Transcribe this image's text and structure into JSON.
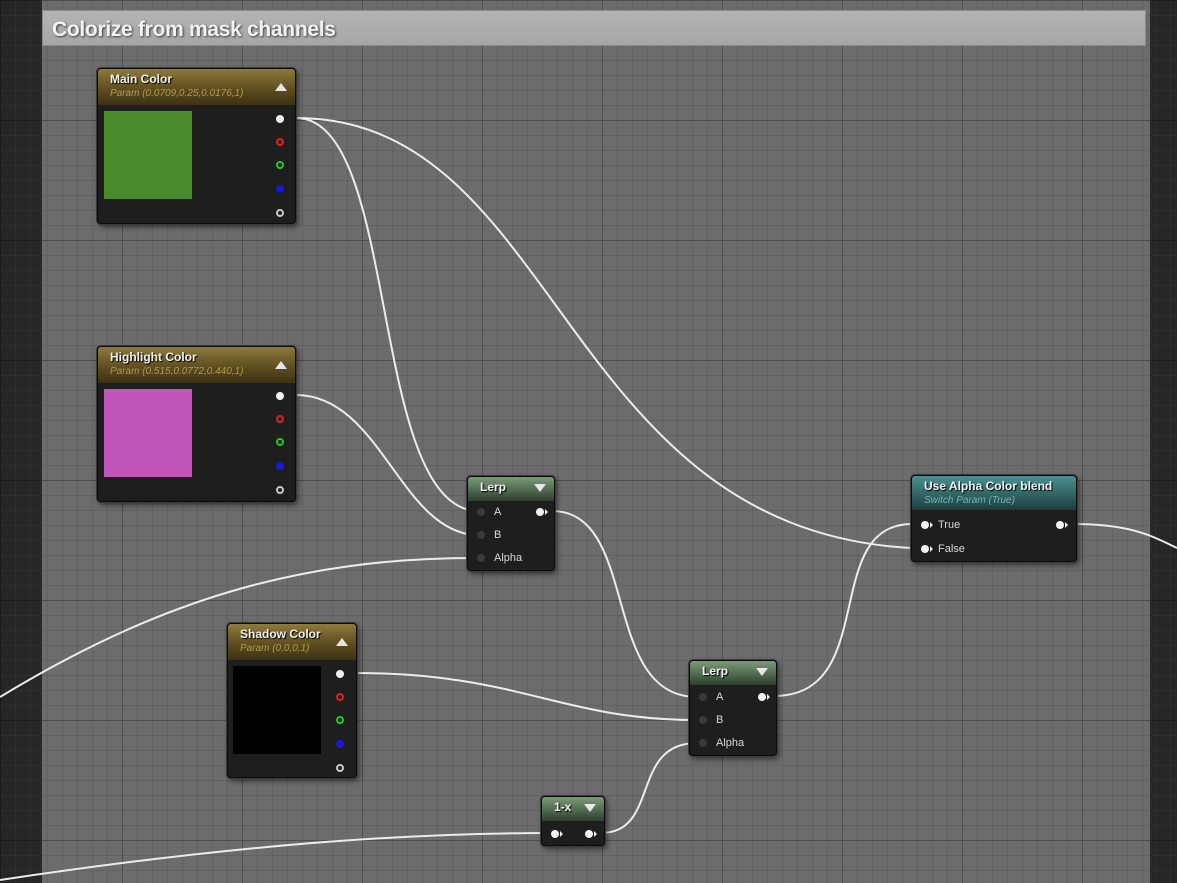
{
  "comment": {
    "title": "Colorize from mask channels"
  },
  "nodes": {
    "main_color": {
      "title": "Main Color",
      "subtitle": "Param (0.0709,0.25,0.0176,1)",
      "swatch_color": "#4a8a2a"
    },
    "highlight_color": {
      "title": "Highlight Color",
      "subtitle": "Param (0.515,0.0772,0.440,1)",
      "swatch_color": "#c255b8"
    },
    "shadow_color": {
      "title": "Shadow Color",
      "subtitle": "Param (0,0,0,1)",
      "swatch_color": "#000000"
    },
    "lerp1": {
      "title": "Lerp",
      "pins": {
        "a": "A",
        "b": "B",
        "alpha": "Alpha"
      }
    },
    "lerp2": {
      "title": "Lerp",
      "pins": {
        "a": "A",
        "b": "B",
        "alpha": "Alpha"
      }
    },
    "one_minus": {
      "title": "1-x"
    },
    "switch": {
      "title": "Use Alpha Color blend",
      "subtitle": "Switch Param (True)",
      "pins": {
        "true": "True",
        "false": "False"
      }
    }
  },
  "colors": {
    "wire": "#ececec",
    "pin_red": "#e02020",
    "pin_green": "#1ecc1e",
    "pin_blue": "#1818d8",
    "param_header": "#8d7a3c",
    "math_header": "#5a7458",
    "switch_header": "#2c5c5e"
  }
}
